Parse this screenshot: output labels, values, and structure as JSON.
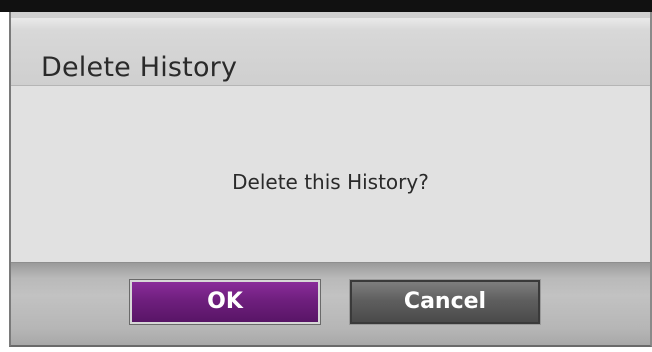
{
  "dialog": {
    "title": "Delete History",
    "message": "Delete this History?",
    "buttons": {
      "ok_label": "OK",
      "cancel_label": "Cancel"
    }
  },
  "colors": {
    "ok_button": "#6f1f7e",
    "cancel_button": "#5f5f5f",
    "dialog_background": "#e1e1e1"
  }
}
